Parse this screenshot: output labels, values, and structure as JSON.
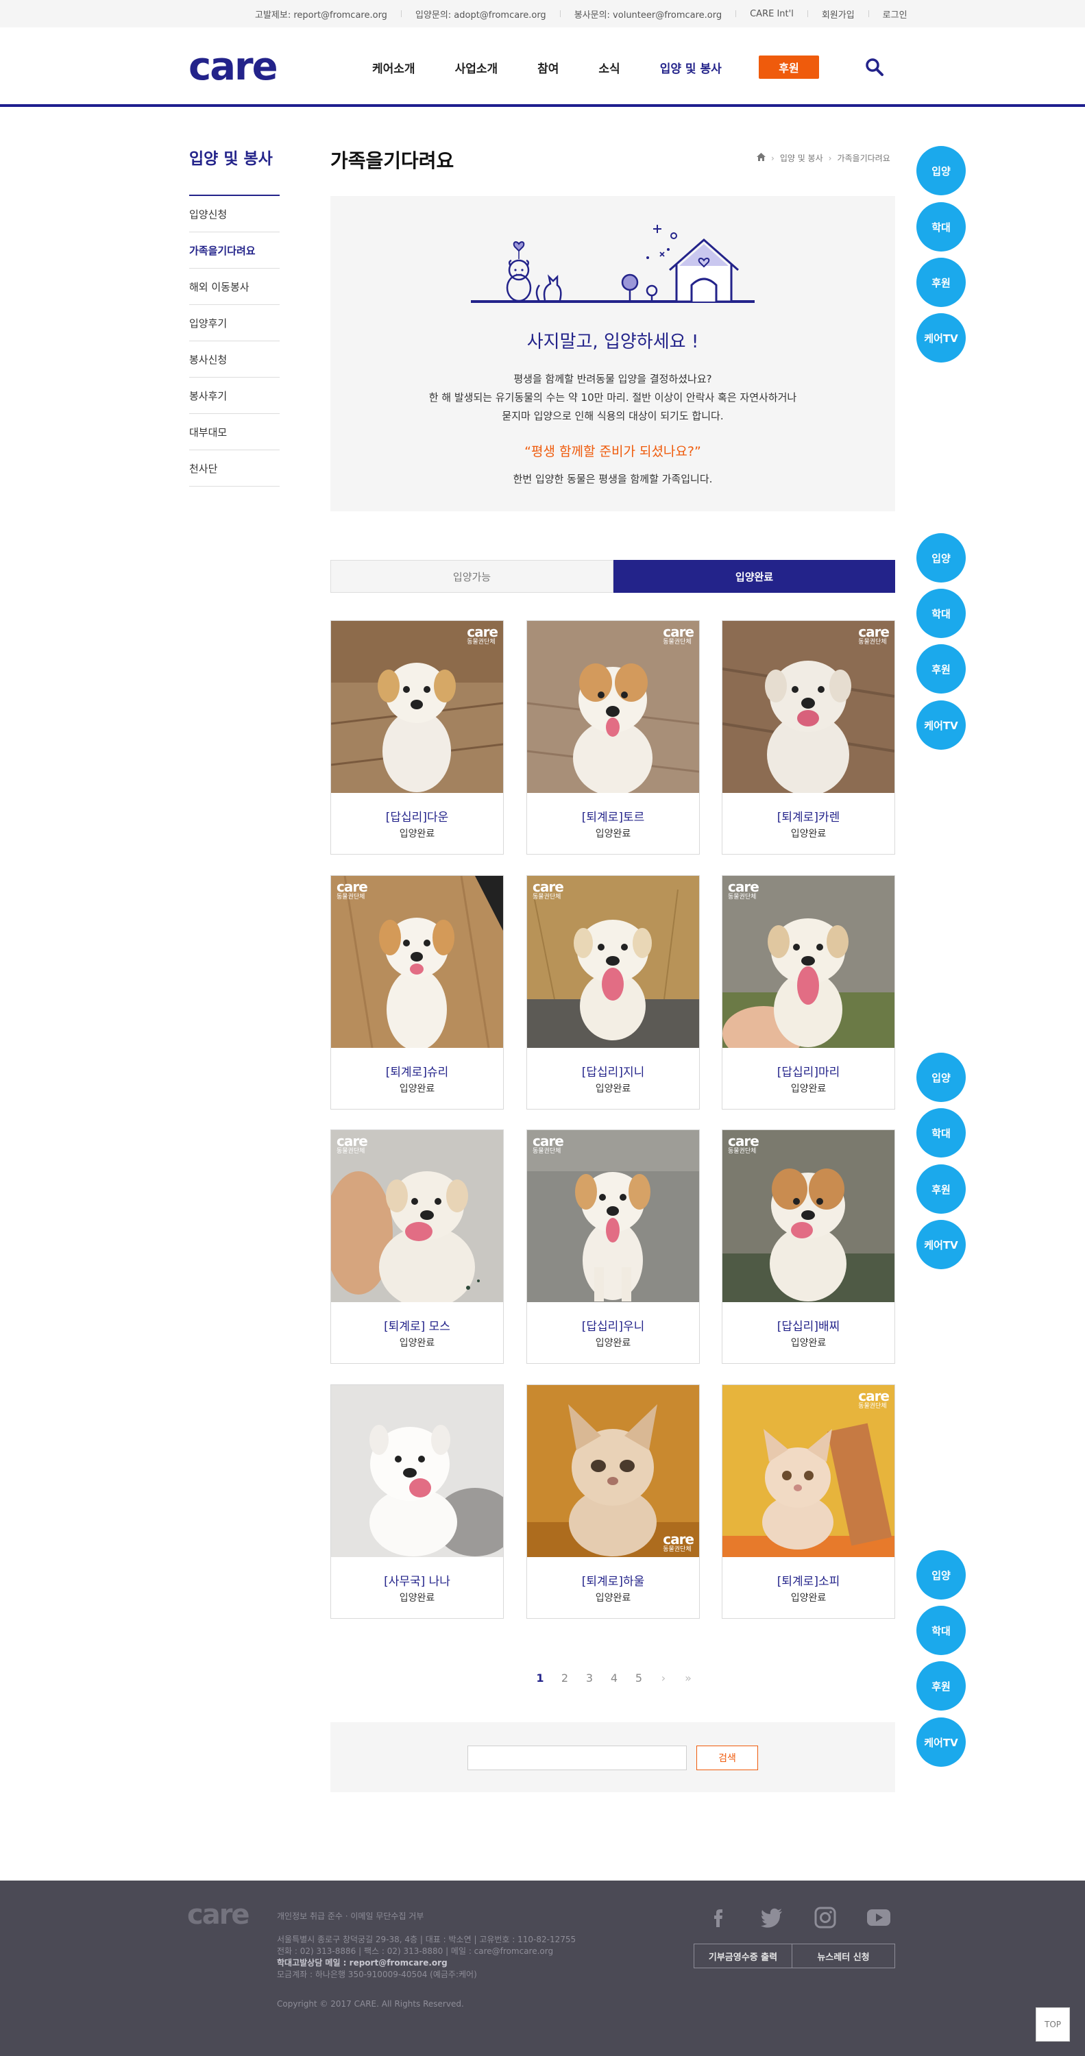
{
  "topbar": {
    "links": [
      "고발제보: report@fromcare.org",
      "입양문의: adopt@fromcare.org",
      "봉사문의: volunteer@fromcare.org",
      "CARE Int'l",
      "회원가입",
      "로그인"
    ]
  },
  "header": {
    "logo": "care",
    "nav": [
      "케어소개",
      "사업소개",
      "참여",
      "소식",
      "입양 및 봉사"
    ],
    "donate_label": "후원",
    "search_icon": "search-icon"
  },
  "lnb": {
    "title": "입양 및 봉사",
    "items": [
      "입양신청",
      "가족을기다려요",
      "해외 이동봉사",
      "입양후기",
      "봉사신청",
      "봉사후기",
      "대부대모",
      "천사단"
    ]
  },
  "content": {
    "title": "가족을기다려요",
    "breadcrumb": [
      "입양 및 봉사",
      "가족을기다려요"
    ]
  },
  "intro": {
    "heading": "사지말고, 입양하세요 !",
    "line1": "평생을 함께할 반려동물 입양을 결정하셨나요?",
    "line2": "한 해 발생되는 유기동물의 수는 약 10만 마리. 절반 이상이 안락사 혹은 자연사하거나",
    "line3": "묻지마 입양으로 인해 식용의 대상이 되기도 합니다.",
    "quote": "“평생 함께할 준비가 되셨나요?”",
    "line4": "한번 입양한 동물은 평생을 함께할 가족입니다."
  },
  "tabs": {
    "available": "입양가능",
    "completed": "입양완료"
  },
  "watermark": {
    "brand": "care",
    "sub": "동물권단체"
  },
  "cards": [
    {
      "name": "[답십리]다운",
      "status": "입양완료"
    },
    {
      "name": "[퇴계로]토르",
      "status": "입양완료"
    },
    {
      "name": "[퇴계로]카렌",
      "status": "입양완료"
    },
    {
      "name": "[퇴계로]슈리",
      "status": "입양완료"
    },
    {
      "name": "[답십리]지니",
      "status": "입양완료"
    },
    {
      "name": "[답십리]마리",
      "status": "입양완료"
    },
    {
      "name": "[퇴계로] 모스",
      "status": "입양완료"
    },
    {
      "name": "[답십리]우니",
      "status": "입양완료"
    },
    {
      "name": "[답십리]배찌",
      "status": "입양완료"
    },
    {
      "name": "[사무국] 나나",
      "status": "입양완료"
    },
    {
      "name": "[퇴계로]하울",
      "status": "입양완료"
    },
    {
      "name": "[퇴계로]소피",
      "status": "입양완료"
    }
  ],
  "float_buttons": [
    "입양",
    "학대",
    "후원",
    "케어TV"
  ],
  "pagination": {
    "pages": [
      "1",
      "2",
      "3",
      "4",
      "5"
    ],
    "current": "1",
    "next": "›",
    "last": "»"
  },
  "search": {
    "value": "",
    "submit_label": "검색"
  },
  "footer": {
    "logo": "care",
    "policy": "개인정보 취급 준수 · 이메일 무단수집 거부",
    "address": "서울특별시 종로구 창덕궁길 29-38, 4층 | 대표 : 박소연 | 고유번호 : 110-82-12755",
    "contact": "전화 : 02) 313-8886 | 팩스 : 02) 313-8880 | 메일 : care@fromcare.org",
    "report": "학대고발상담 메일 : report@fromcare.org",
    "account": "모금계좌 : 하나은행 350-910009-40504 (예금주:케어)",
    "copyright": "Copyright © 2017 CARE. All Rights Reserved.",
    "receipt_button": "기부금영수증 출력",
    "newsletter_button": "뉴스레터 신청",
    "top_button": "TOP"
  },
  "colors": {
    "brand_navy": "#23238a",
    "accent_orange": "#ef5b0c",
    "float_blue": "#1ba9ec",
    "footer_bg": "#4b4a55"
  }
}
